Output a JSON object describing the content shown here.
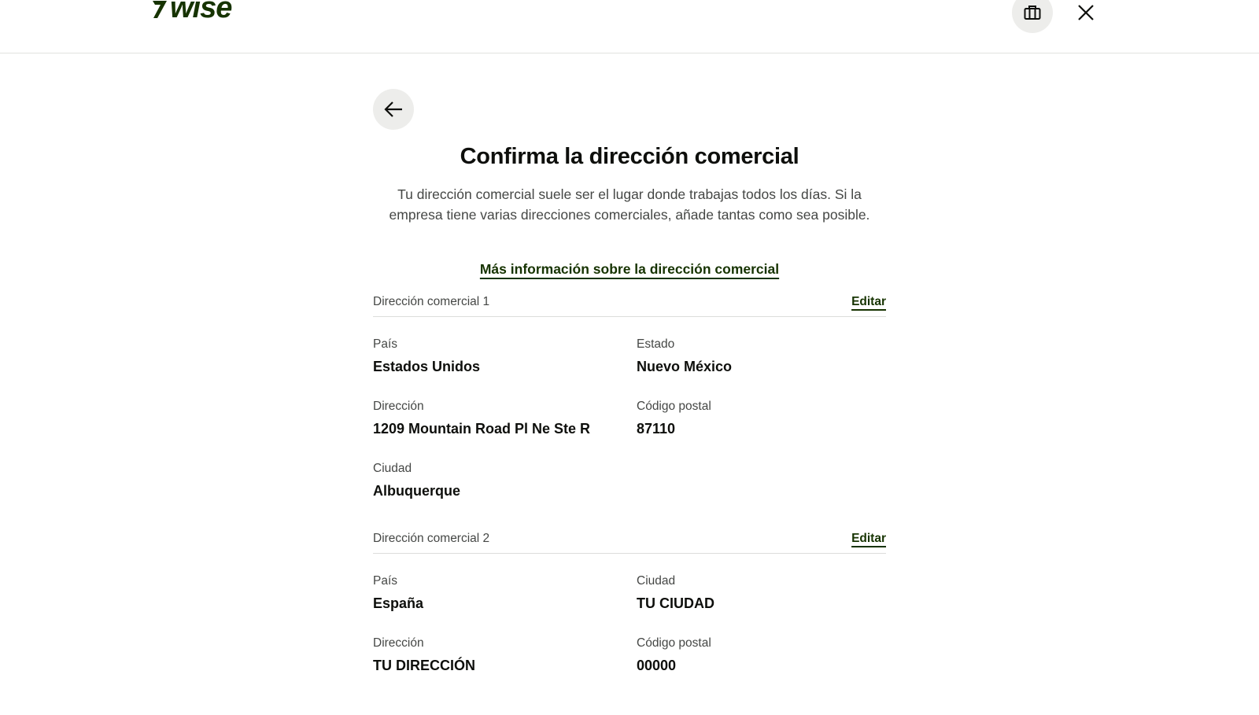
{
  "header": {
    "logo_text": "wise",
    "briefcase_icon": "briefcase-icon",
    "close_icon": "close-icon"
  },
  "back_icon": "arrow-left-icon",
  "page": {
    "title": "Confirma la dirección comercial",
    "subtitle": "Tu dirección comercial suele ser el lugar donde trabajas todos los días. Si la empresa tiene varias direcciones comerciales, añade tantas como sea posible.",
    "more_info_link": "Más información sobre la dirección comercial"
  },
  "addresses": [
    {
      "title": "Dirección comercial 1",
      "edit_label": "Editar",
      "fields": [
        {
          "label": "País",
          "value": "Estados Unidos"
        },
        {
          "label": "Estado",
          "value": "Nuevo México"
        },
        {
          "label": "Dirección",
          "value": "1209 Mountain Road Pl Ne Ste R"
        },
        {
          "label": "Código postal",
          "value": "87110"
        },
        {
          "label": "Ciudad",
          "value": "Albuquerque"
        }
      ]
    },
    {
      "title": "Dirección comercial 2",
      "edit_label": "Editar",
      "fields": [
        {
          "label": "País",
          "value": "España"
        },
        {
          "label": "Ciudad",
          "value": "TU CIUDAD"
        },
        {
          "label": "Dirección",
          "value": "TU DIRECCIÓN"
        },
        {
          "label": "Código postal",
          "value": "00000"
        }
      ]
    }
  ],
  "colors": {
    "brand_green": "#163300",
    "icon_button_bg": "#ededeb",
    "text_primary": "#0e0f0c",
    "text_secondary": "#454745"
  }
}
